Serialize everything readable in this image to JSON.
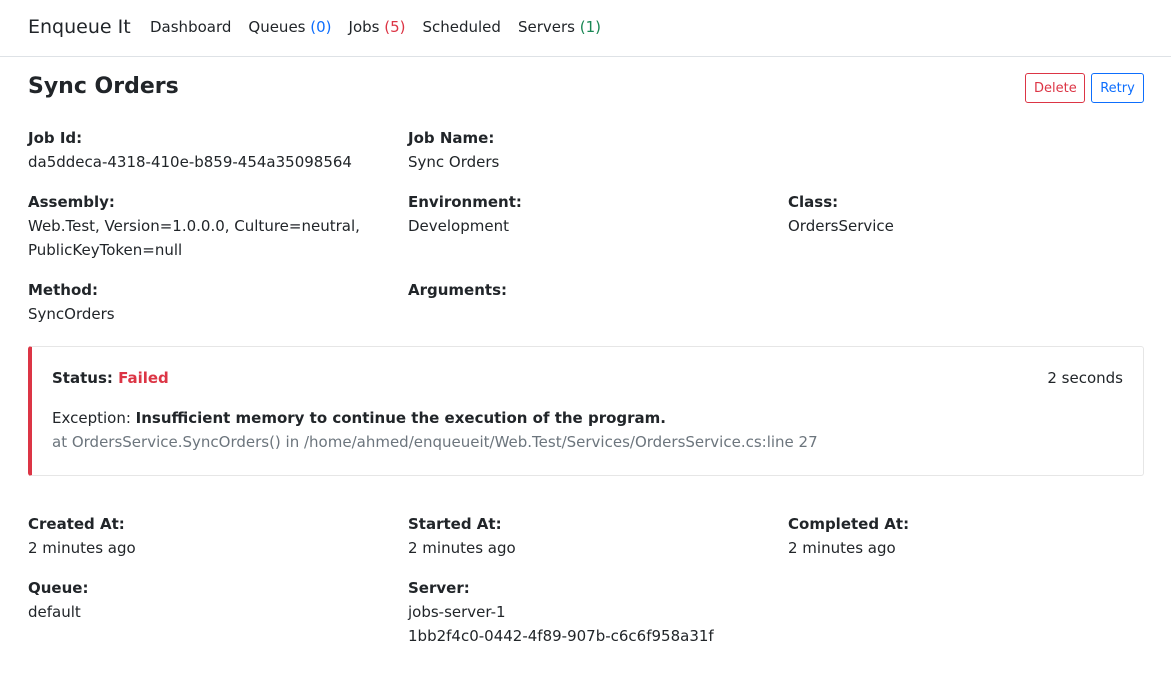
{
  "navbar": {
    "brand": "Enqueue It",
    "items": [
      {
        "label": "Dashboard",
        "count": ""
      },
      {
        "label": "Queues",
        "count": "(0)"
      },
      {
        "label": "Jobs",
        "count": "(5)"
      },
      {
        "label": "Scheduled",
        "count": ""
      },
      {
        "label": "Servers",
        "count": "(1)"
      }
    ]
  },
  "job": {
    "title": "Sync Orders",
    "actions": {
      "delete": "Delete",
      "retry": "Retry"
    },
    "fields": {
      "job_id": {
        "label": "Job Id:",
        "value": "da5ddeca-4318-410e-b859-454a35098564"
      },
      "job_name": {
        "label": "Job Name:",
        "value": "Sync Orders"
      },
      "assembly": {
        "label": "Assembly:",
        "value": "Web.Test, Version=1.0.0.0, Culture=neutral,\nPublicKeyToken=null"
      },
      "environment": {
        "label": "Environment:",
        "value": "Development"
      },
      "class": {
        "label": "Class:",
        "value": "OrdersService"
      },
      "method": {
        "label": "Method:",
        "value": "SyncOrders"
      },
      "arguments": {
        "label": "Arguments:",
        "value": ""
      }
    },
    "status": {
      "label": "Status:",
      "value": "Failed",
      "duration": "2 seconds",
      "exception_label": "Exception:",
      "exception_message": "Insufficient memory to continue the execution of the program.",
      "stack_trace": "at OrdersService.SyncOrders() in /home/ahmed/enqueueit/Web.Test/Services/OrdersService.cs:line 27"
    },
    "timing": {
      "created": {
        "label": "Created At:",
        "value": "2 minutes ago"
      },
      "started": {
        "label": "Started At:",
        "value": "2 minutes ago"
      },
      "completed": {
        "label": "Completed At:",
        "value": "2 minutes ago"
      },
      "queue": {
        "label": "Queue:",
        "value": "default"
      },
      "server": {
        "label": "Server:",
        "value": "jobs-server-1\n1bb2f4c0-0442-4f89-907b-c6c6f958a31f"
      }
    }
  },
  "colors": {
    "danger": "#dc3545",
    "primary": "#0d6efd",
    "success": "#198754",
    "muted": "#6c757d"
  }
}
